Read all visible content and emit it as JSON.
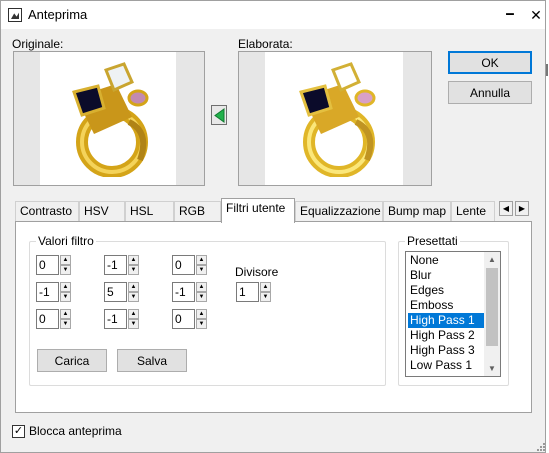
{
  "window": {
    "title": "Anteprima",
    "minimize_glyph": "🗕",
    "maximize_glyph": "☐",
    "close_glyph": "✕"
  },
  "preview": {
    "original_label": "Originale:",
    "processed_label": "Elaborata:",
    "transfer_icon": "green-left-arrow-icon"
  },
  "buttons": {
    "ok": "OK",
    "cancel": "Annulla",
    "load": "Carica",
    "save": "Salva"
  },
  "tabs": [
    {
      "label": "Contrasto"
    },
    {
      "label": "HSV"
    },
    {
      "label": "HSL"
    },
    {
      "label": "RGB"
    },
    {
      "label": "Filtri utente"
    },
    {
      "label": "Equalizzazione"
    },
    {
      "label": "Bump map"
    },
    {
      "label": "Lente"
    }
  ],
  "active_tab": "Filtri utente",
  "filter": {
    "group_title": "Valori filtro",
    "matrix": [
      "0",
      "-1",
      "0",
      "-1",
      "5",
      "-1",
      "0",
      "-1",
      "0"
    ],
    "divisor_label": "Divisore",
    "divisor_value": "1"
  },
  "presets": {
    "group_title": "Presettati",
    "items": [
      "None",
      "Blur",
      "Edges",
      "Emboss",
      "High Pass 1",
      "High Pass 2",
      "High Pass 3",
      "Low Pass 1"
    ],
    "selected": "High Pass 1"
  },
  "lock_preview": {
    "label": "Blocca anteprima",
    "checked": true
  },
  "colors": {
    "accent": "#0078d7",
    "arrow_green": "#22b14c"
  }
}
